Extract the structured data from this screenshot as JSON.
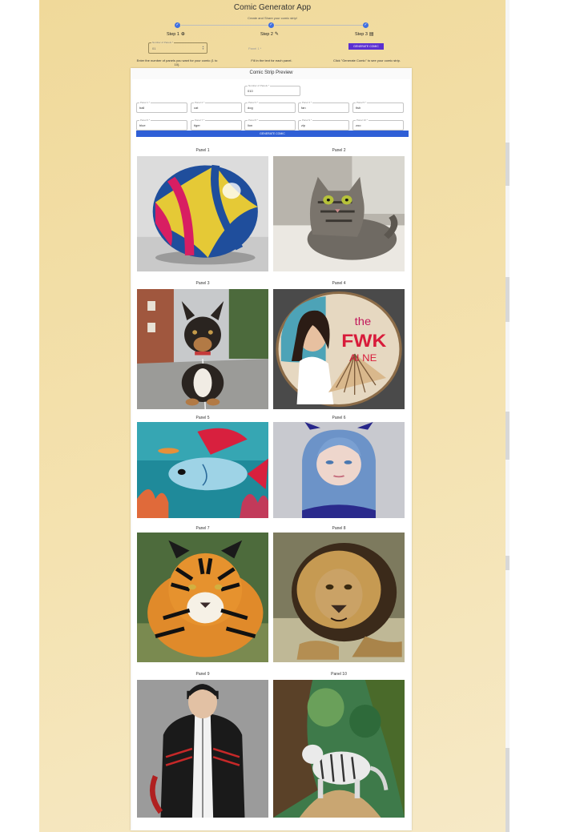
{
  "app": {
    "title": "Comic Generator App",
    "subtitle": "Create and Share your comic strip!"
  },
  "stepper": {
    "steps": [
      {
        "label": "Step 1",
        "icon": "add-circle-icon",
        "glyph": "⊕",
        "done": true
      },
      {
        "label": "Step 2",
        "icon": "pencil-icon",
        "glyph": "✎",
        "done": true
      },
      {
        "label": "Step 3",
        "icon": "comment-icon",
        "glyph": "▤",
        "done": true
      }
    ],
    "check_glyph": "✓",
    "number_field": {
      "label": "Number of Panels *",
      "value": "01"
    },
    "panel1_placeholder": "Panel 1 *",
    "generate_label": "GENERATE COMIC",
    "help": [
      "Enter the number of panels you want for your comic (1 to 10).",
      "Fill in the text for each panel.",
      "Click \"Generate Comic\" to see your comic strip."
    ]
  },
  "preview": {
    "title": "Comic Strip Preview",
    "number_field": {
      "label": "Number of Panels *",
      "value": "010"
    },
    "inputs": [
      {
        "label": "Panel 1 *",
        "value": "ball"
      },
      {
        "label": "Panel 2 *",
        "value": "cat"
      },
      {
        "label": "Panel 3 *",
        "value": "dog"
      },
      {
        "label": "Panel 4 *",
        "value": "fan"
      },
      {
        "label": "Panel 5 *",
        "value": "fish"
      },
      {
        "label": "Panel 6 *",
        "value": "blue"
      },
      {
        "label": "Panel 7 *",
        "value": "tiger"
      },
      {
        "label": "Panel 8 *",
        "value": "lion"
      },
      {
        "label": "Panel 9 *",
        "value": "zip"
      },
      {
        "label": "Panel 10 *",
        "value": "zoo"
      }
    ],
    "generate_label": "GENERATE COMIC",
    "panels": [
      {
        "label": "Panel 1",
        "subject": "ball"
      },
      {
        "label": "Panel 2",
        "subject": "cat"
      },
      {
        "label": "Panel 3",
        "subject": "dog"
      },
      {
        "label": "Panel 4",
        "subject": "fan",
        "sign_text": [
          "the",
          "FWK",
          "AI NE"
        ]
      },
      {
        "label": "Panel 5",
        "subject": "fish"
      },
      {
        "label": "Panel 6",
        "subject": "blue"
      },
      {
        "label": "Panel 7",
        "subject": "tiger"
      },
      {
        "label": "Panel 8",
        "subject": "lion"
      },
      {
        "label": "Panel 9",
        "subject": "zip"
      },
      {
        "label": "Panel 10",
        "subject": "zoo"
      }
    ]
  },
  "colors": {
    "accent_purple": "#5b2fd1",
    "accent_blue": "#2f5fd6",
    "step_blue": "#3f6fe0"
  }
}
